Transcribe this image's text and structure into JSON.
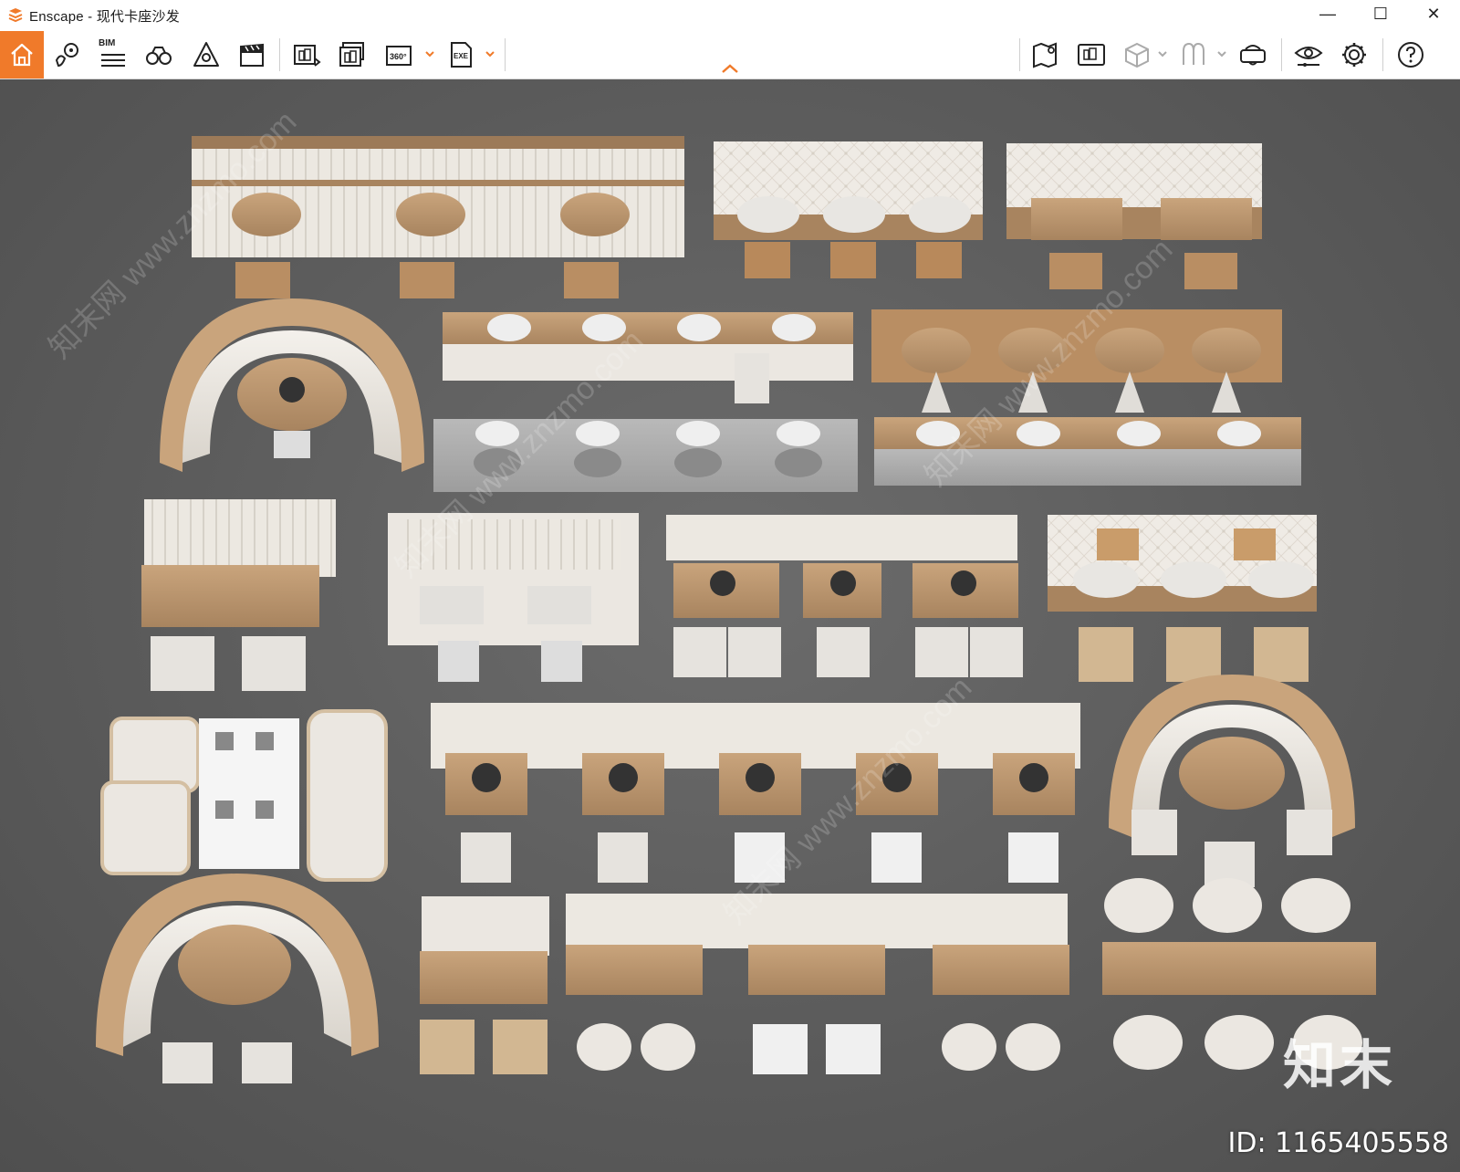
{
  "window": {
    "title": "Enscape - 现代卡座沙发",
    "minimize_label": "—",
    "maximize_label": "☐",
    "close_label": "✕"
  },
  "toolbar": {
    "accent_color": "#f07a2a",
    "bim_label": "BIM",
    "left_tools": [
      {
        "name": "home",
        "icon": "home-icon"
      },
      {
        "name": "location",
        "icon": "location-pin-icon"
      },
      {
        "name": "bim",
        "icon": "bim-list-icon"
      },
      {
        "name": "views",
        "icon": "binoculars-icon"
      },
      {
        "name": "sun",
        "icon": "sun-pyramid-icon"
      },
      {
        "name": "video",
        "icon": "clapperboard-icon"
      },
      {
        "name": "screenshot",
        "icon": "render-image-icon"
      },
      {
        "name": "batch",
        "icon": "batch-render-icon"
      },
      {
        "name": "panorama",
        "icon": "panorama-360-icon"
      },
      {
        "name": "export",
        "icon": "exe-export-icon"
      }
    ],
    "right_tools": [
      {
        "name": "map",
        "icon": "map-icon"
      },
      {
        "name": "gallery",
        "icon": "gallery-icon"
      },
      {
        "name": "asset-library",
        "icon": "cube-icon"
      },
      {
        "name": "materials",
        "icon": "materials-icon"
      },
      {
        "name": "vr",
        "icon": "vr-headset-icon"
      },
      {
        "name": "visual-settings",
        "icon": "eye-settings-icon"
      },
      {
        "name": "settings",
        "icon": "gear-icon"
      },
      {
        "name": "help",
        "icon": "help-icon"
      }
    ]
  },
  "viewport": {
    "background": "#5a5a5a",
    "watermark_text": "知末网 www.znzmo.com",
    "brand_text": "知末",
    "asset_id": "ID: 1165405558"
  }
}
